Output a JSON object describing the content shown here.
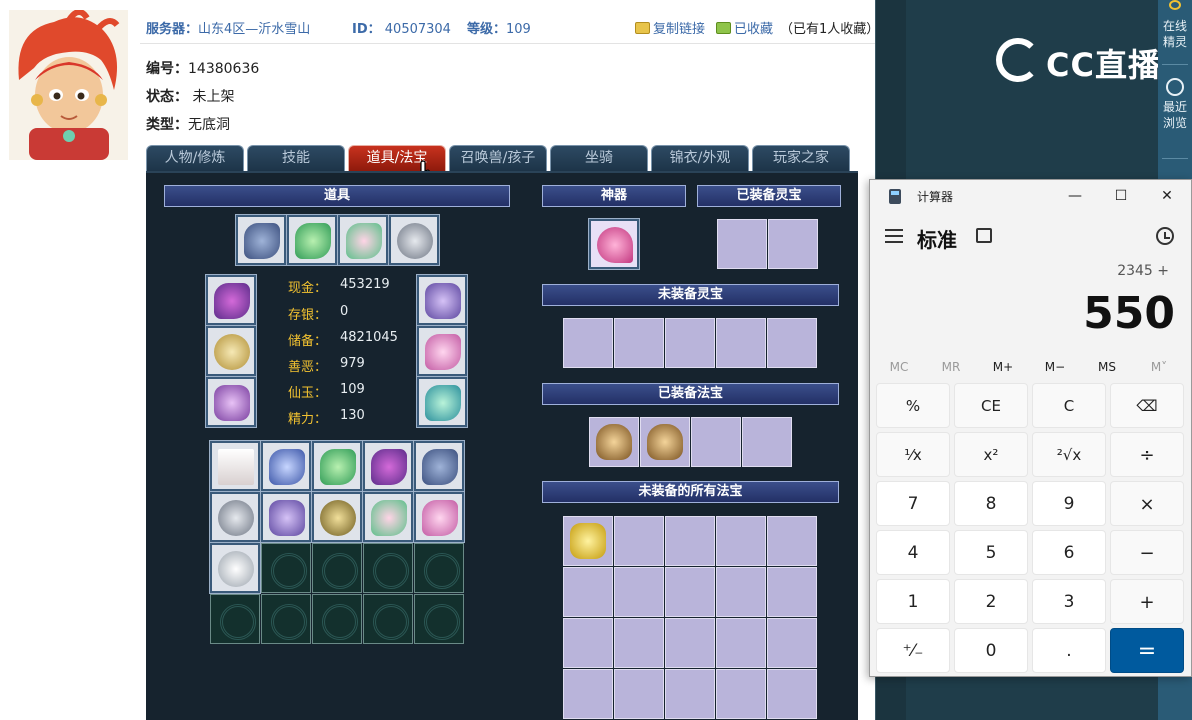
{
  "header": {
    "server_label": "服务器：",
    "server_value": "山东4区—沂水雪山",
    "id_label": "ID：",
    "id_value": "40507304",
    "level_label": "等级：",
    "level_value": "109",
    "copy_link": "复制链接",
    "favorited": "已收藏",
    "fav_count": "（已有1人收藏）"
  },
  "info": {
    "serial_label": "编号：",
    "serial_value": "14380636",
    "status_label": "状态：",
    "status_value": "未上架",
    "type_label": "类型：",
    "type_value": "无底洞"
  },
  "tabs": [
    "人物/修炼",
    "技能",
    "道具/法宝",
    "召唤兽/孩子",
    "坐骑",
    "锦衣/外观",
    "玩家之家"
  ],
  "active_tab": "道具/法宝",
  "panel": {
    "items_title": "道具",
    "artifact_title": "神器",
    "equipped_spirit_title": "已装备灵宝",
    "unequipped_spirit_title": "未装备灵宝",
    "equipped_magic_title": "已装备法宝",
    "all_magic_title": "未装备的所有法宝"
  },
  "stats": [
    {
      "label": "现金：",
      "value": "453219"
    },
    {
      "label": "存银：",
      "value": "0"
    },
    {
      "label": "储备：",
      "value": "4821045"
    },
    {
      "label": "善恶：",
      "value": "979"
    },
    {
      "label": "仙玉：",
      "value": "109"
    },
    {
      "label": "精力：",
      "value": "130"
    }
  ],
  "colors": {
    "accent_blue": "#3c6aa8",
    "tab_active": "#c8321e",
    "stat_label": "#f2c230",
    "calc_equals": "#005a9e"
  },
  "cc": {
    "logo": "CC直播",
    "side_online": "在线精灵",
    "side_recent": "最近浏览"
  },
  "calculator": {
    "title": "计算器",
    "mode": "标准",
    "expression": "2345 +",
    "display": "550",
    "memory": [
      "MC",
      "MR",
      "M+",
      "M−",
      "MS",
      "M˅"
    ],
    "keys": [
      [
        "%",
        "CE",
        "C",
        "⌫"
      ],
      [
        "¹⁄x",
        "x²",
        "²√x",
        "÷"
      ],
      [
        "7",
        "8",
        "9",
        "×"
      ],
      [
        "4",
        "5",
        "6",
        "−"
      ],
      [
        "1",
        "2",
        "3",
        "+"
      ],
      [
        "⁺⁄₋",
        "0",
        ".",
        "="
      ]
    ]
  }
}
